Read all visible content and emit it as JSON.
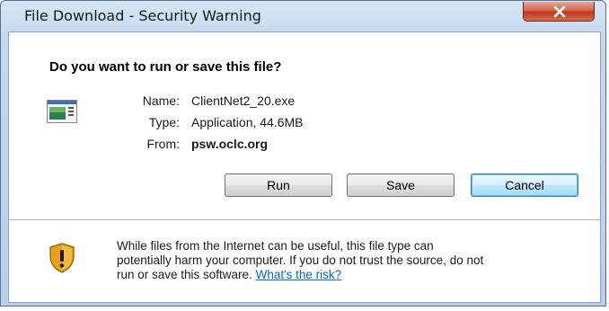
{
  "window": {
    "title": "File Download - Security Warning"
  },
  "dialog": {
    "question": "Do you want to run or save this file?",
    "file": {
      "name_label": "Name:",
      "name_value": "ClientNet2_20.exe",
      "type_label": "Type:",
      "type_value": "Application, 44.6MB",
      "from_label": "From:",
      "from_value": "psw.oclc.org"
    },
    "buttons": {
      "run": "Run",
      "save": "Save",
      "cancel": "Cancel"
    },
    "warning": {
      "line1": "While files from the Internet can be useful, this file type can",
      "line2": "potentially harm your computer. If you do not trust the source, do not",
      "line3_prefix": "run or save this software. ",
      "link": "What's the risk?"
    }
  },
  "icons": {
    "file": "application-file-icon",
    "warning": "shield-warning-icon",
    "close": "close-icon"
  },
  "colors": {
    "link": "#0066cc",
    "close_button": "#c0391e",
    "default_button_border": "#3c7fb1"
  }
}
